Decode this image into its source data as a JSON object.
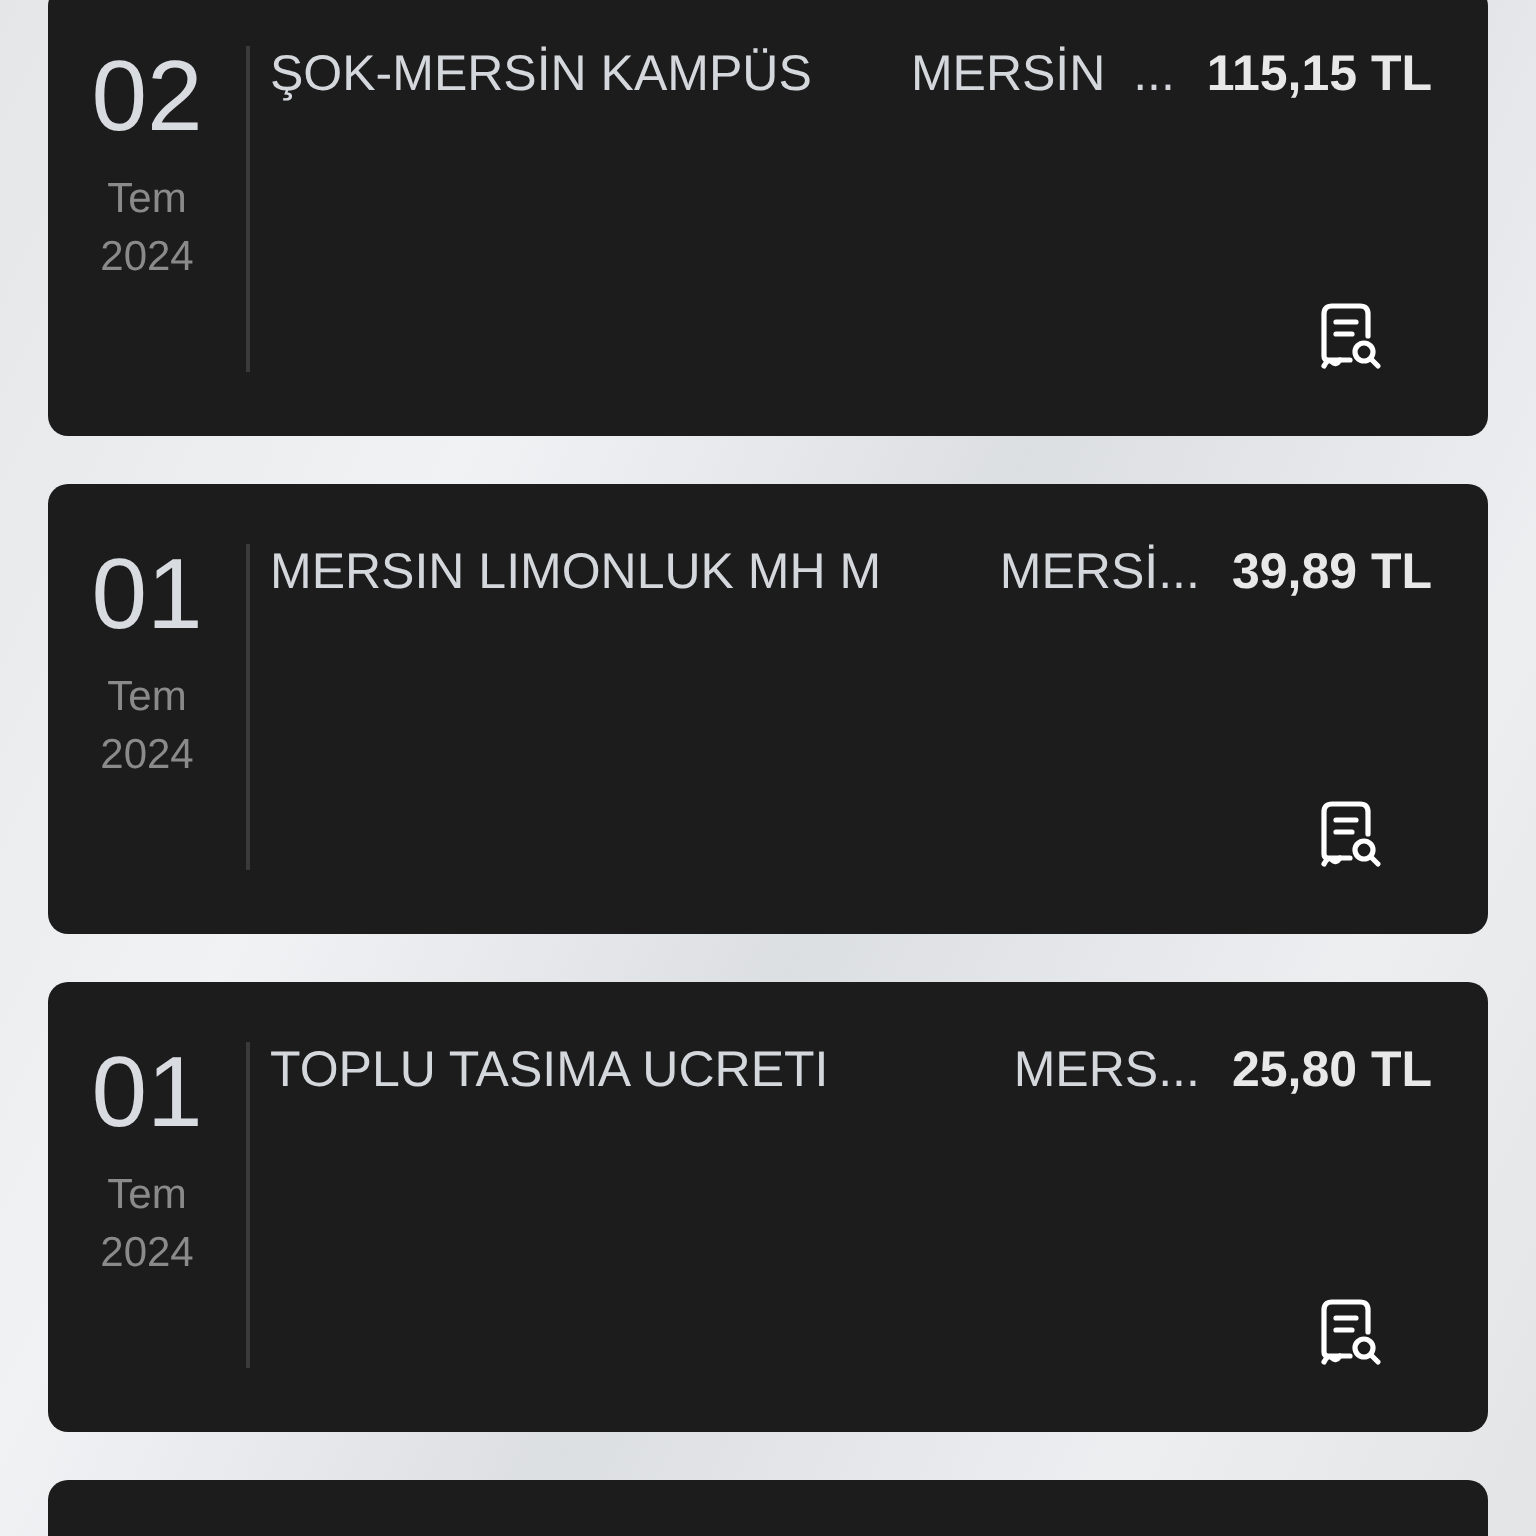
{
  "transactions": [
    {
      "kind": "full",
      "day": "02",
      "month": "Tem",
      "year": "2024",
      "merchant": "ŞOK-MERSİN KAMPÜS",
      "location": "MERSİN  ...",
      "amount": "115,15 TL"
    },
    {
      "kind": "full",
      "day": "01",
      "month": "Tem",
      "year": "2024",
      "merchant": "MERSIN LIMONLUK MH M",
      "location": "MERSİ...",
      "amount": "39,89 TL"
    },
    {
      "kind": "full",
      "day": "01",
      "month": "Tem",
      "year": "2024",
      "merchant": "TOPLU TASIMA UCRETI",
      "location": "MERS...",
      "amount": "25,80 TL"
    },
    {
      "kind": "partial"
    }
  ]
}
